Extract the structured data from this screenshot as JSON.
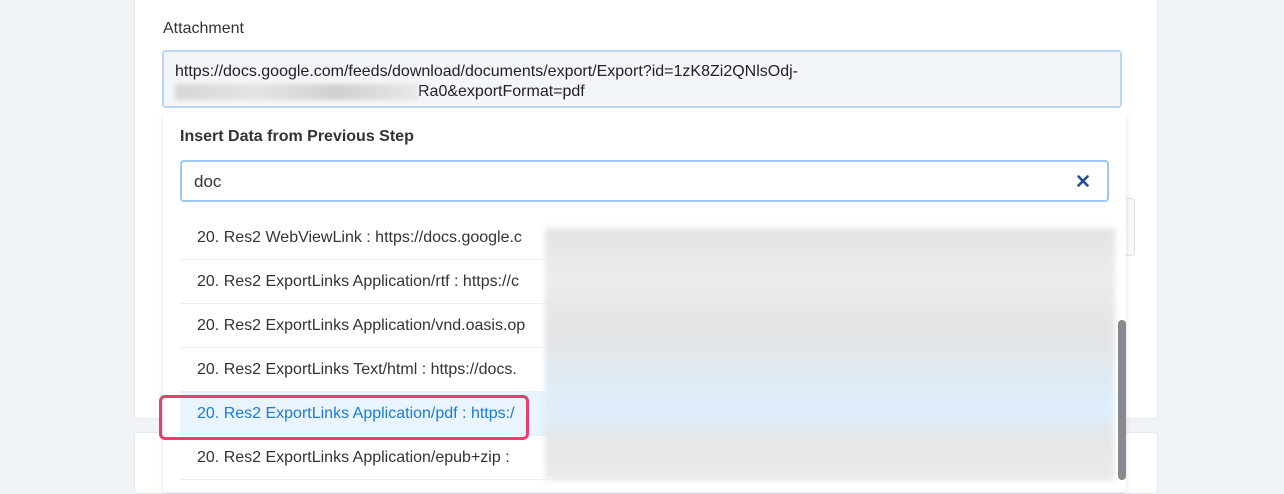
{
  "attachment": {
    "label": "Attachment",
    "url_line1": "https://docs.google.com/feeds/download/documents/export/Export?id=1zK8Zi2QNlsOdj-",
    "url_line2_suffix": "Ra0&exportFormat=pdf"
  },
  "dropdown": {
    "header": "Insert Data from Previous Step",
    "search": {
      "value": "doc",
      "placeholder": ""
    },
    "items": [
      {
        "label": "20. Res2 WebViewLink : https://docs.google.c",
        "selected": false
      },
      {
        "label": "20. Res2 ExportLinks Application/rtf : https://c",
        "selected": false
      },
      {
        "label": "20. Res2 ExportLinks Application/vnd.oasis.op",
        "selected": false
      },
      {
        "label": "20. Res2 ExportLinks Text/html : https://docs.",
        "selected": false
      },
      {
        "label": "20. Res2 ExportLinks Application/pdf : https:/",
        "selected": true
      },
      {
        "label": "20. Res2 ExportLinks Application/epub+zip :",
        "selected": false
      }
    ]
  },
  "colors": {
    "accent": "#1a7bd8",
    "highlight": "#ec3e6d",
    "selected_bg": "#e9f4fe"
  }
}
